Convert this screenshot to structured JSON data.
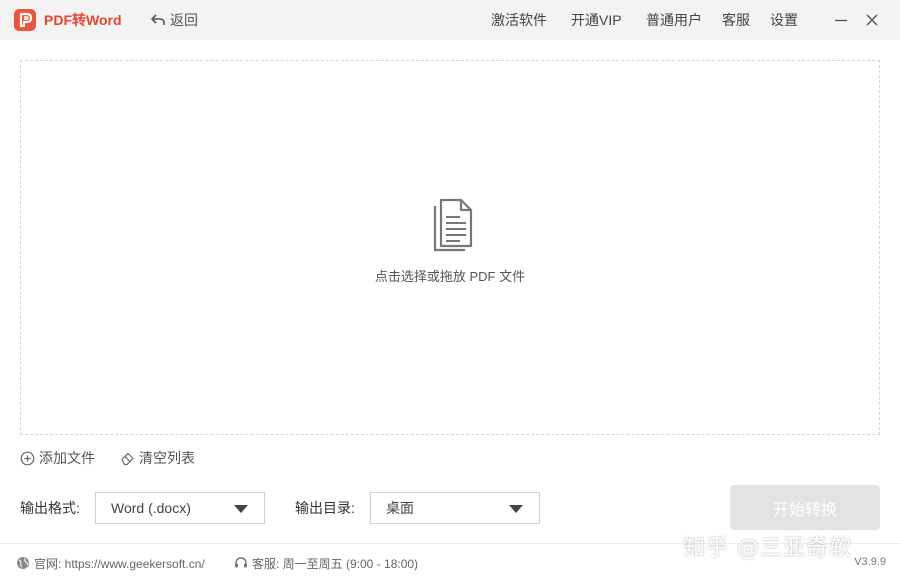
{
  "app": {
    "title": "PDF转Word",
    "back_label": "返回"
  },
  "nav": {
    "activate": "激活软件",
    "vip": "开通VIP",
    "user": "普通用户",
    "support": "客服",
    "settings": "设置"
  },
  "dropzone": {
    "text": "点击选择或拖放 PDF 文件",
    "icon": "document-icon"
  },
  "file_actions": {
    "add": "添加文件",
    "clear": "清空列表"
  },
  "output": {
    "format_label": "输出格式:",
    "format_value": "Word (.docx)",
    "dir_label": "输出目录:",
    "dir_value": "桌面"
  },
  "start_button": "开始转换",
  "status": {
    "website": "官网: https://www.geekersoft.cn/",
    "service": "客服: 周一至周五 (9:00 - 18:00)"
  },
  "watermark": "知乎 @三亚奇软",
  "version": "V3.9.9",
  "colors": {
    "brand": "#e8452f",
    "button_disabled": "#e3e3e3"
  }
}
